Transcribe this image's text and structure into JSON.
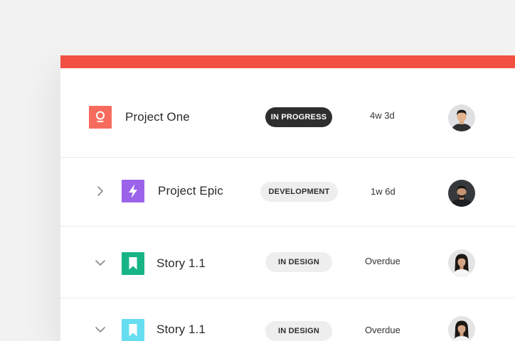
{
  "accent_color": "#f25043",
  "rows": [
    {
      "name": "Project One",
      "status": "IN PROGRESS",
      "status_style": "dark",
      "time": "4w 3d",
      "icon": "lightbulb-icon",
      "icon_color": "#f76b5c",
      "chevron": "none"
    },
    {
      "name": "Project Epic",
      "status": "DEVELOPMENT",
      "status_style": "light",
      "time": "1w 6d",
      "icon": "lightning-icon",
      "icon_color": "#9a63ea",
      "chevron": "chevron-right-icon"
    },
    {
      "name": "Story 1.1",
      "status": "IN DESIGN",
      "status_style": "light",
      "time": "Overdue",
      "icon": "bookmark-icon",
      "icon_color": "#17b487",
      "chevron": "chevron-down-icon"
    },
    {
      "name": "Story 1.1",
      "status": "IN DESIGN",
      "status_style": "light",
      "time": "Overdue",
      "icon": "bookmark-icon",
      "icon_color": "#66ddf1",
      "chevron": "chevron-down-icon"
    }
  ]
}
